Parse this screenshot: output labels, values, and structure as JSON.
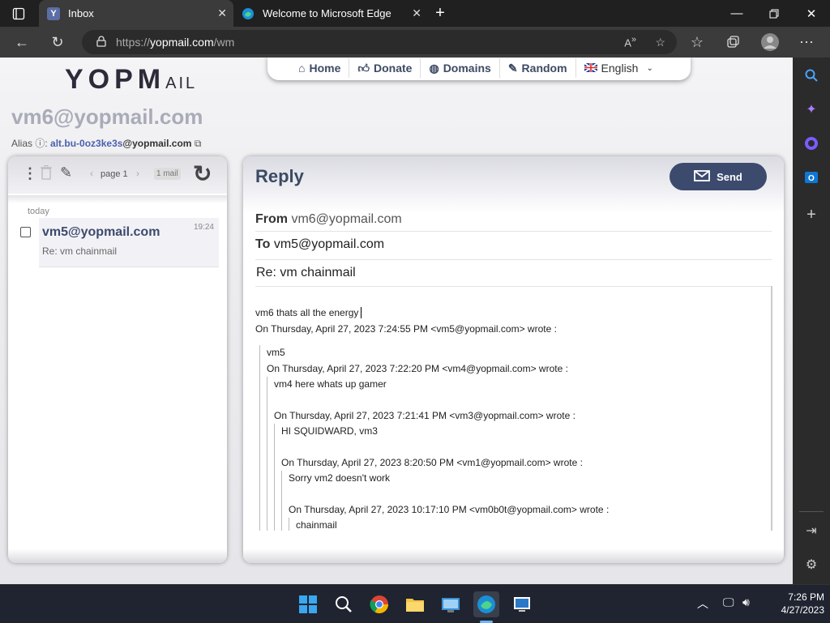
{
  "browser": {
    "tabs": [
      {
        "title": "Inbox",
        "favicon": "Y"
      },
      {
        "title": "Welcome to Microsoft Edge",
        "favicon": "edge"
      }
    ],
    "url_prefix": "https://",
    "url_host": "yopmail.com",
    "url_path": "/wm"
  },
  "site": {
    "logo_main": "YOPM",
    "logo_tail": "AIL",
    "nav": [
      {
        "label": "Home",
        "icon": "home-icon"
      },
      {
        "label": "Donate",
        "icon": "thumbs-up-icon"
      },
      {
        "label": "Domains",
        "icon": "globe-icon"
      },
      {
        "label": "Random",
        "icon": "wand-icon"
      }
    ],
    "language": "English",
    "mailbox_address": "vm6@yopmail.com",
    "alias_label": "Alias",
    "alias_value": "alt.bu-0oz3ke3s",
    "alias_domain": "@yopmail.com"
  },
  "inbox": {
    "page_label": "page 1",
    "mail_count": "1 mail",
    "day_label": "today",
    "items": [
      {
        "sender": "vm5@yopmail.com",
        "subject": "Re: vm chainmail",
        "time": "19:24"
      }
    ]
  },
  "reply": {
    "title": "Reply",
    "send_label": "Send",
    "from_label": "From",
    "from_value": "vm6@yopmail.com",
    "to_label": "To",
    "to_value": "vm5@yopmail.com",
    "subject": "Re: vm chainmail",
    "body_first": "vm6 thats all the energy",
    "body_lines": [
      "On Thursday, April 27, 2023 7:24:55 PM <vm5@yopmail.com> wrote :",
      "vm5",
      "On Thursday, April 27, 2023 7:22:20 PM <vm4@yopmail.com> wrote :",
      "vm4 here whats up gamer",
      "On Thursday, April 27, 2023 7:21:41 PM <vm3@yopmail.com> wrote :",
      "HI SQUIDWARD, vm3",
      "On Thursday, April 27, 2023 8:20:50 PM <vm1@yopmail.com> wrote :",
      "Sorry vm2 doesn't work",
      "On Thursday, April 27, 2023 10:17:10 PM <vm0b0t@yopmail.com> wrote :",
      "chainmail"
    ]
  },
  "taskbar": {
    "time": "7:26 PM",
    "date": "4/27/2023"
  }
}
